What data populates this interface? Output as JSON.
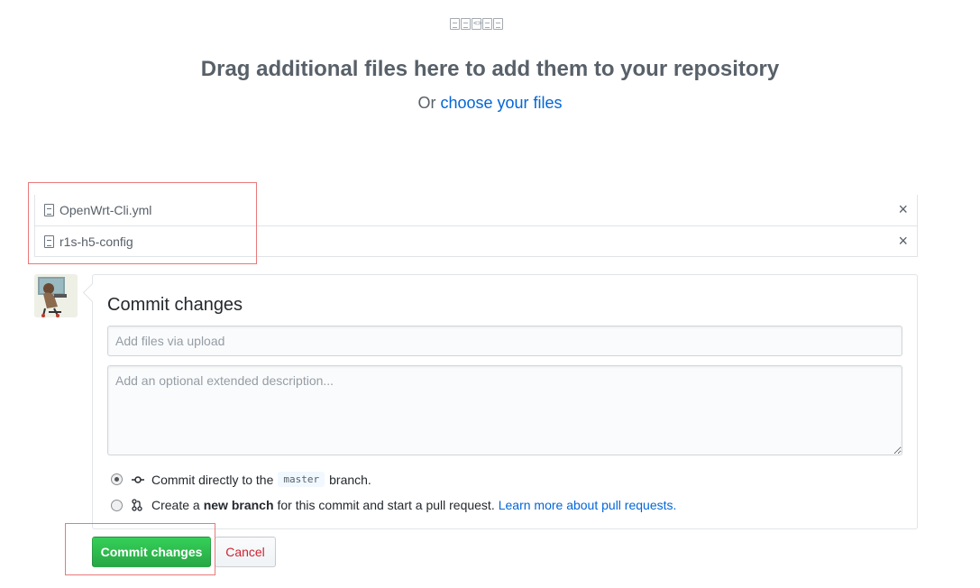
{
  "drop_zone": {
    "title": "Drag additional files here to add them to your repository",
    "or_text": "Or",
    "choose_link": "choose your files",
    "icons": [
      "file-icon",
      "file-binary-icon",
      "file-code-icon",
      "file-text-icon",
      "file-media-icon"
    ]
  },
  "files": [
    {
      "name": "OpenWrt-Cli.yml",
      "icon": "file-icon",
      "remove": "×"
    },
    {
      "name": "r1s-h5-config",
      "icon": "file-icon",
      "remove": "×"
    }
  ],
  "commit": {
    "title": "Commit changes",
    "summary_placeholder": "Add files via upload",
    "description_placeholder": "Add an optional extended description...",
    "option_direct": {
      "prefix": "Commit directly to the",
      "branch": "master",
      "suffix": "branch.",
      "selected": true
    },
    "option_new_branch": {
      "prefix": "Create a",
      "bold": "new branch",
      "suffix": "for this commit and start a pull request.",
      "link": "Learn more about pull requests.",
      "selected": false
    }
  },
  "buttons": {
    "commit_label": "Commit changes",
    "cancel_label": "Cancel"
  },
  "colors": {
    "link": "#0366d6",
    "commit_button": "#28a745",
    "cancel_text": "#cb2431",
    "highlight_box": "#e9787a"
  }
}
